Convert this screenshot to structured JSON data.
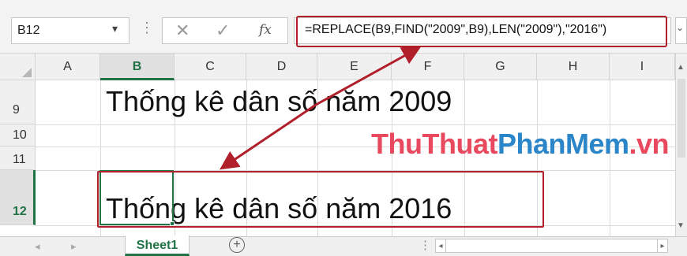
{
  "name_box": {
    "value": "B12",
    "dropdown_icon": "chevron-down-icon"
  },
  "formula_bar": {
    "cancel_icon": "✕",
    "enter_icon": "✓",
    "fx_label": "fx",
    "formula": "=REPLACE(B9,FIND(\"2009\",B9),LEN(\"2009\"),\"2016\")"
  },
  "columns": [
    "A",
    "B",
    "C",
    "D",
    "E",
    "F",
    "G",
    "H",
    "I"
  ],
  "active_column": "B",
  "rows": [
    "9",
    "10",
    "11",
    "12"
  ],
  "active_row": "12",
  "cells": {
    "B9": "Thống kê dân số năm 2009",
    "B12": "Thống kê dân số năm 2016"
  },
  "watermark": {
    "part1": "ThuThuat",
    "part2": "PhanMem",
    "part3": ".vn"
  },
  "sheet_tabs": [
    "Sheet1"
  ],
  "add_sheet_label": "+",
  "colors": {
    "accent": "#217346",
    "highlight": "#b11f2a"
  }
}
